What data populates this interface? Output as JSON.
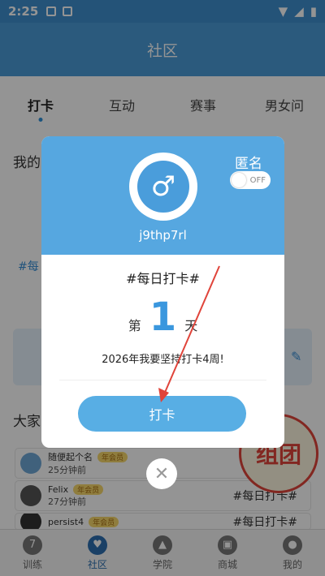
{
  "status_bar": {
    "time": "2:25"
  },
  "header": {
    "title": "社区"
  },
  "tabs": [
    {
      "label": "打卡",
      "active": true
    },
    {
      "label": "互动",
      "active": false
    },
    {
      "label": "赛事",
      "active": false
    },
    {
      "label": "男女问",
      "active": false
    }
  ],
  "background": {
    "my_title": "我的",
    "hash_partial": "#每",
    "everyone_title": "大家",
    "feed": [
      {
        "name": "随便起个名",
        "badge": "年会员",
        "time": "25分钟前",
        "tag": "#"
      },
      {
        "name": "Felix",
        "badge": "年会员",
        "time": "27分钟前",
        "tag": "#每日打卡#"
      },
      {
        "name": "persist4",
        "badge": "年会员",
        "time": "",
        "tag": "#每日打卡#"
      }
    ],
    "tuan_label": "组团"
  },
  "modal": {
    "anon_label": "匿名",
    "toggle_state": "OFF",
    "username": "j9thp7rl",
    "topic": "#每日打卡#",
    "day_prefix": "第",
    "day_number": "1",
    "day_suffix": "天",
    "goal": "2026年我要坚持打卡4周!",
    "checkin_button": "打卡"
  },
  "bottom_nav": [
    {
      "label": "训练",
      "icon": "7",
      "active": false
    },
    {
      "label": "社区",
      "icon": "♥",
      "active": true
    },
    {
      "label": "学院",
      "icon": "▲",
      "active": false
    },
    {
      "label": "商城",
      "icon": "▣",
      "active": false
    },
    {
      "label": "我的",
      "icon": "●",
      "active": false
    }
  ],
  "colors": {
    "primary": "#4a9bd8",
    "accent": "#3a97de",
    "arrow": "#e0443a"
  }
}
